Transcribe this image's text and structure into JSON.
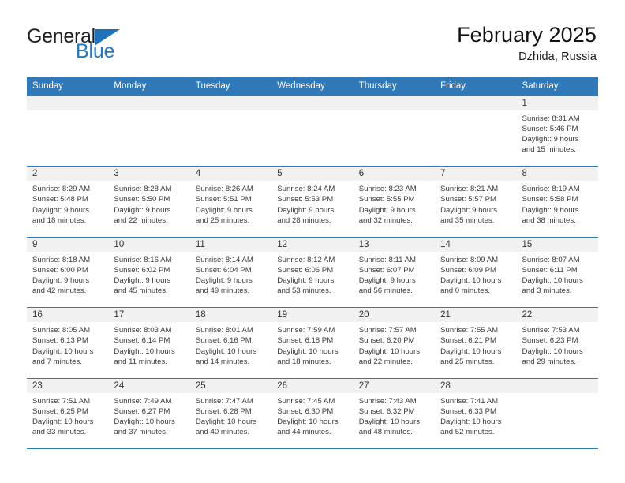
{
  "brand": {
    "name_part1": "General",
    "name_part2": "Blue",
    "triangle_color": "#1f72b8",
    "blue_color": "#2079c4"
  },
  "header": {
    "title": "February 2025",
    "subtitle": "Dzhida, Russia"
  },
  "theme": {
    "header_bar_color": "#3079b8",
    "daynum_strip_color": "#f1f1f1",
    "row_separator_color": "#3079b8"
  },
  "calendar": {
    "weekday_headers": [
      "Sunday",
      "Monday",
      "Tuesday",
      "Wednesday",
      "Thursday",
      "Friday",
      "Saturday"
    ],
    "weeks": [
      [
        {
          "day": "",
          "lines": []
        },
        {
          "day": "",
          "lines": []
        },
        {
          "day": "",
          "lines": []
        },
        {
          "day": "",
          "lines": []
        },
        {
          "day": "",
          "lines": []
        },
        {
          "day": "",
          "lines": []
        },
        {
          "day": "1",
          "lines": [
            "Sunrise: 8:31 AM",
            "Sunset: 5:46 PM",
            "Daylight: 9 hours",
            "and 15 minutes."
          ]
        }
      ],
      [
        {
          "day": "2",
          "lines": [
            "Sunrise: 8:29 AM",
            "Sunset: 5:48 PM",
            "Daylight: 9 hours",
            "and 18 minutes."
          ]
        },
        {
          "day": "3",
          "lines": [
            "Sunrise: 8:28 AM",
            "Sunset: 5:50 PM",
            "Daylight: 9 hours",
            "and 22 minutes."
          ]
        },
        {
          "day": "4",
          "lines": [
            "Sunrise: 8:26 AM",
            "Sunset: 5:51 PM",
            "Daylight: 9 hours",
            "and 25 minutes."
          ]
        },
        {
          "day": "5",
          "lines": [
            "Sunrise: 8:24 AM",
            "Sunset: 5:53 PM",
            "Daylight: 9 hours",
            "and 28 minutes."
          ]
        },
        {
          "day": "6",
          "lines": [
            "Sunrise: 8:23 AM",
            "Sunset: 5:55 PM",
            "Daylight: 9 hours",
            "and 32 minutes."
          ]
        },
        {
          "day": "7",
          "lines": [
            "Sunrise: 8:21 AM",
            "Sunset: 5:57 PM",
            "Daylight: 9 hours",
            "and 35 minutes."
          ]
        },
        {
          "day": "8",
          "lines": [
            "Sunrise: 8:19 AM",
            "Sunset: 5:58 PM",
            "Daylight: 9 hours",
            "and 38 minutes."
          ]
        }
      ],
      [
        {
          "day": "9",
          "lines": [
            "Sunrise: 8:18 AM",
            "Sunset: 6:00 PM",
            "Daylight: 9 hours",
            "and 42 minutes."
          ]
        },
        {
          "day": "10",
          "lines": [
            "Sunrise: 8:16 AM",
            "Sunset: 6:02 PM",
            "Daylight: 9 hours",
            "and 45 minutes."
          ]
        },
        {
          "day": "11",
          "lines": [
            "Sunrise: 8:14 AM",
            "Sunset: 6:04 PM",
            "Daylight: 9 hours",
            "and 49 minutes."
          ]
        },
        {
          "day": "12",
          "lines": [
            "Sunrise: 8:12 AM",
            "Sunset: 6:06 PM",
            "Daylight: 9 hours",
            "and 53 minutes."
          ]
        },
        {
          "day": "13",
          "lines": [
            "Sunrise: 8:11 AM",
            "Sunset: 6:07 PM",
            "Daylight: 9 hours",
            "and 56 minutes."
          ]
        },
        {
          "day": "14",
          "lines": [
            "Sunrise: 8:09 AM",
            "Sunset: 6:09 PM",
            "Daylight: 10 hours",
            "and 0 minutes."
          ]
        },
        {
          "day": "15",
          "lines": [
            "Sunrise: 8:07 AM",
            "Sunset: 6:11 PM",
            "Daylight: 10 hours",
            "and 3 minutes."
          ]
        }
      ],
      [
        {
          "day": "16",
          "lines": [
            "Sunrise: 8:05 AM",
            "Sunset: 6:13 PM",
            "Daylight: 10 hours",
            "and 7 minutes."
          ]
        },
        {
          "day": "17",
          "lines": [
            "Sunrise: 8:03 AM",
            "Sunset: 6:14 PM",
            "Daylight: 10 hours",
            "and 11 minutes."
          ]
        },
        {
          "day": "18",
          "lines": [
            "Sunrise: 8:01 AM",
            "Sunset: 6:16 PM",
            "Daylight: 10 hours",
            "and 14 minutes."
          ]
        },
        {
          "day": "19",
          "lines": [
            "Sunrise: 7:59 AM",
            "Sunset: 6:18 PM",
            "Daylight: 10 hours",
            "and 18 minutes."
          ]
        },
        {
          "day": "20",
          "lines": [
            "Sunrise: 7:57 AM",
            "Sunset: 6:20 PM",
            "Daylight: 10 hours",
            "and 22 minutes."
          ]
        },
        {
          "day": "21",
          "lines": [
            "Sunrise: 7:55 AM",
            "Sunset: 6:21 PM",
            "Daylight: 10 hours",
            "and 25 minutes."
          ]
        },
        {
          "day": "22",
          "lines": [
            "Sunrise: 7:53 AM",
            "Sunset: 6:23 PM",
            "Daylight: 10 hours",
            "and 29 minutes."
          ]
        }
      ],
      [
        {
          "day": "23",
          "lines": [
            "Sunrise: 7:51 AM",
            "Sunset: 6:25 PM",
            "Daylight: 10 hours",
            "and 33 minutes."
          ]
        },
        {
          "day": "24",
          "lines": [
            "Sunrise: 7:49 AM",
            "Sunset: 6:27 PM",
            "Daylight: 10 hours",
            "and 37 minutes."
          ]
        },
        {
          "day": "25",
          "lines": [
            "Sunrise: 7:47 AM",
            "Sunset: 6:28 PM",
            "Daylight: 10 hours",
            "and 40 minutes."
          ]
        },
        {
          "day": "26",
          "lines": [
            "Sunrise: 7:45 AM",
            "Sunset: 6:30 PM",
            "Daylight: 10 hours",
            "and 44 minutes."
          ]
        },
        {
          "day": "27",
          "lines": [
            "Sunrise: 7:43 AM",
            "Sunset: 6:32 PM",
            "Daylight: 10 hours",
            "and 48 minutes."
          ]
        },
        {
          "day": "28",
          "lines": [
            "Sunrise: 7:41 AM",
            "Sunset: 6:33 PM",
            "Daylight: 10 hours",
            "and 52 minutes."
          ]
        },
        {
          "day": "",
          "lines": []
        }
      ]
    ]
  }
}
